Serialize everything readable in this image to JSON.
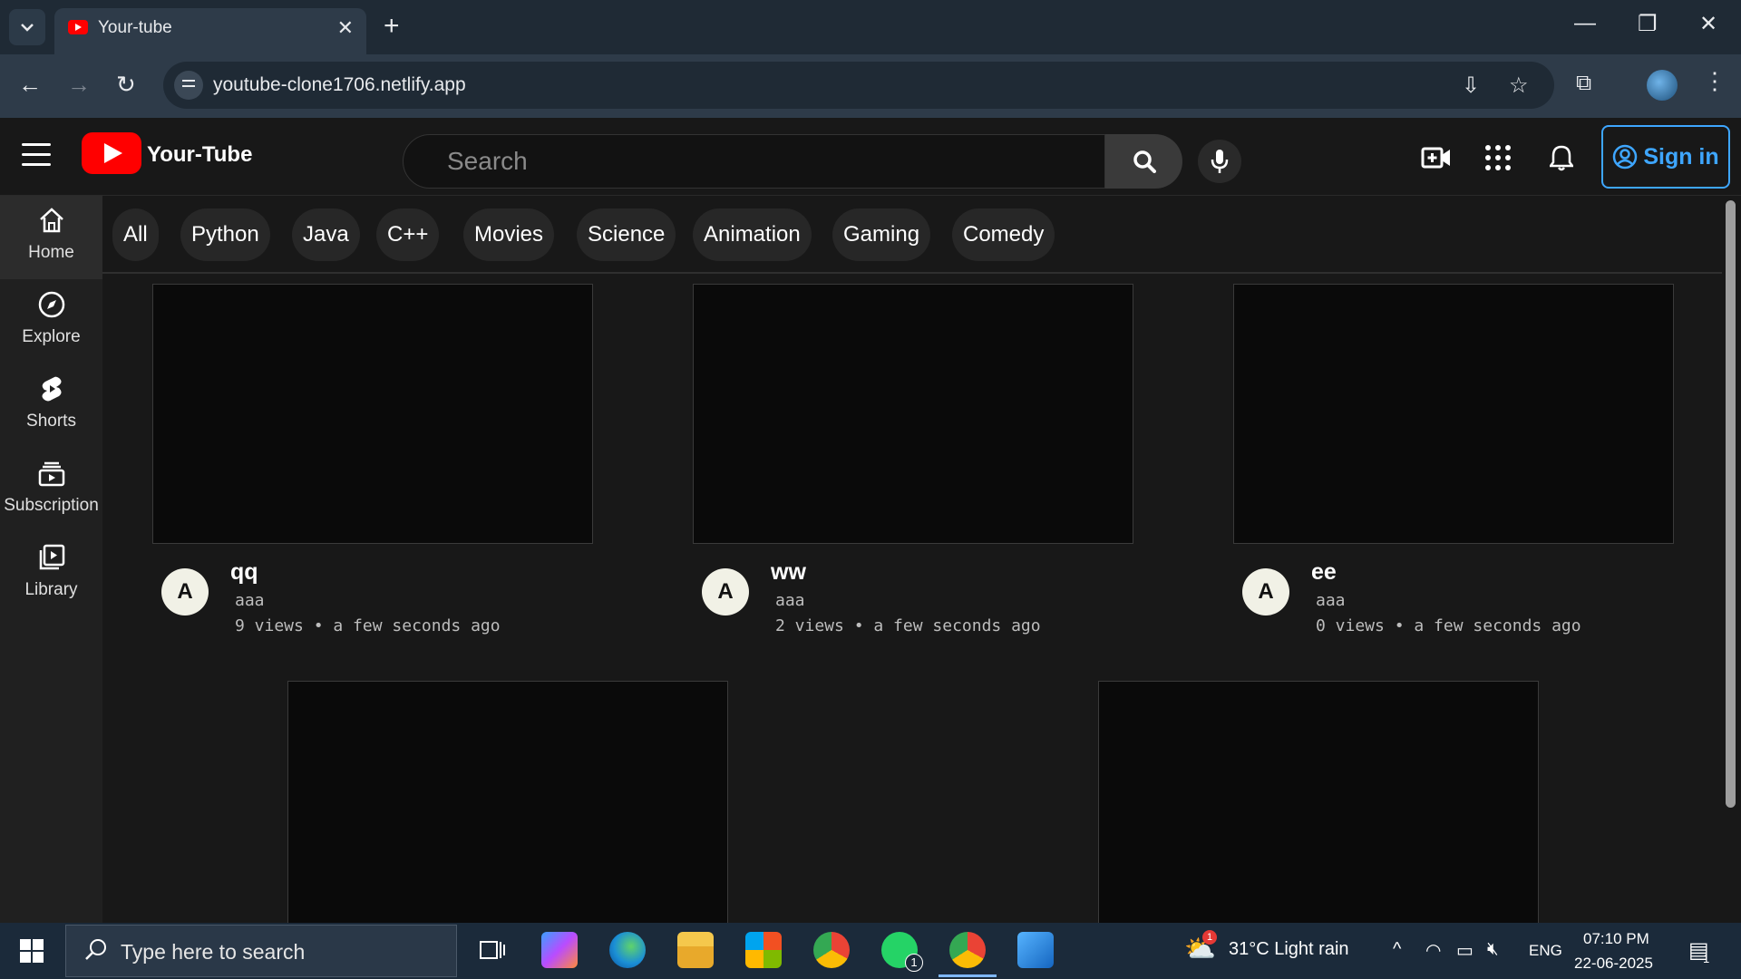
{
  "browser": {
    "tab_title": "Your-tube",
    "url": "youtube-clone1706.netlify.app"
  },
  "header": {
    "brand": "Your-Tube",
    "search_placeholder": "Search",
    "signin_label": "Sign in"
  },
  "sidebar": {
    "items": [
      {
        "label": "Home",
        "icon": "home-icon"
      },
      {
        "label": "Explore",
        "icon": "compass-icon"
      },
      {
        "label": "Shorts",
        "icon": "shorts-icon"
      },
      {
        "label": "Subscription",
        "icon": "subscriptions-icon"
      },
      {
        "label": "Library",
        "icon": "library-icon"
      }
    ]
  },
  "chips": [
    "All",
    "Python",
    "Java",
    "C++",
    "Movies",
    "Science",
    "Animation",
    "Gaming",
    "Comedy"
  ],
  "videos": [
    {
      "avatar": "A",
      "title": "qq",
      "channel": "aaa",
      "views": "9 views",
      "time": "• a few seconds ago"
    },
    {
      "avatar": "A",
      "title": "ww",
      "channel": "aaa",
      "views": "2 views",
      "time": "• a few seconds ago"
    },
    {
      "avatar": "A",
      "title": "ee",
      "channel": "aaa",
      "views": "0 views",
      "time": "• a few seconds ago"
    }
  ],
  "taskbar": {
    "search_placeholder": "Type here to search",
    "weather": "31°C  Light rain",
    "language": "ENG",
    "time": "07:10 PM",
    "date": "22-06-2025",
    "whatsapp_badge": "1",
    "weather_badge": "1",
    "notification_badge": "1"
  },
  "colors": {
    "accent": "#3ea6ff",
    "brand_red": "#ff0000",
    "background": "#181818",
    "sidebar": "#202020"
  }
}
